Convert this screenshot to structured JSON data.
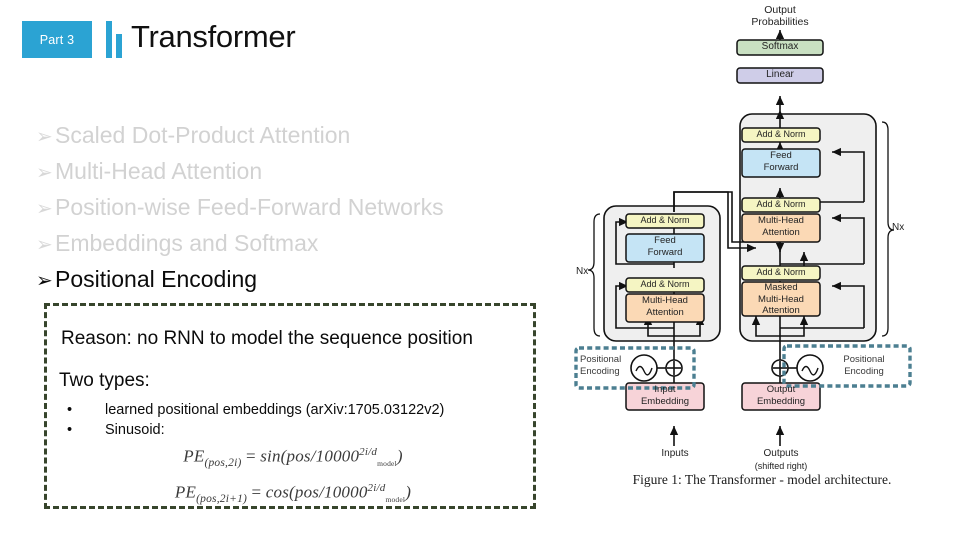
{
  "header": {
    "part_badge": "Part 3",
    "title": "Transformer",
    "accent_color": "#2ba3d3"
  },
  "outline": {
    "items": [
      {
        "bullet": "➢",
        "label": "Scaled Dot-Product Attention",
        "state": "dim"
      },
      {
        "bullet": "➢",
        "label": "Multi-Head Attention",
        "state": "dim"
      },
      {
        "bullet": "➢",
        "label": "Position-wise Feed-Forward Networks",
        "state": "dim"
      },
      {
        "bullet": "➢",
        "label": "Embeddings and Softmax",
        "state": "dim"
      },
      {
        "bullet": "➢",
        "label": "Positional Encoding",
        "state": "active"
      }
    ],
    "dim_color": "#d2d2d2",
    "active_color": "#0b0b0b"
  },
  "reason_box": {
    "border_color": "#37452c",
    "reason_line": "Reason: no RNN to model the sequence position",
    "two_types_heading": "Two types:",
    "sub_bullets": [
      {
        "marker": "•",
        "text": "learned positional embeddings (arXiv:1705.03122v2)"
      },
      {
        "marker": "•",
        "text": "Sinusoid:"
      }
    ],
    "formulas": [
      {
        "lhs_base": "PE",
        "lhs_sub": "(pos,2i)",
        "operator": "=",
        "fn": "sin",
        "arg_prefix": "(pos/10000",
        "exp_num": "2i/",
        "exp_sub": "d",
        "exp_subsub": "model",
        "arg_suffix": ")"
      },
      {
        "lhs_base": "PE",
        "lhs_sub": "(pos,2i+1)",
        "operator": "=",
        "fn": "cos",
        "arg_prefix": "(pos/10000",
        "exp_num": "2i/",
        "exp_sub": "d",
        "exp_subsub": "model",
        "arg_suffix": ")"
      }
    ]
  },
  "diagram": {
    "caption": "Figure 1: The Transformer - model architecture.",
    "top_label_line1": "Output",
    "top_label_line2": "Probabilities",
    "softmax": "Softmax",
    "linear": "Linear",
    "encoder": {
      "nx": "Nx",
      "add_norm_top": "Add & Norm",
      "feed_forward_line1": "Feed",
      "feed_forward_line2": "Forward",
      "add_norm_bottom": "Add & Norm",
      "attention_line1": "Multi-Head",
      "attention_line2": "Attention",
      "pos_enc_line1": "Positional",
      "pos_enc_line2": "Encoding",
      "embedding_line1": "Input",
      "embedding_line2": "Embedding",
      "source_label": "Inputs"
    },
    "decoder": {
      "nx": "Nx",
      "add_norm_top": "Add & Norm",
      "feed_forward_line1": "Feed",
      "feed_forward_line2": "Forward",
      "add_norm_mid": "Add & Norm",
      "attention_mid_line1": "Multi-Head",
      "attention_mid_line2": "Attention",
      "add_norm_bottom": "Add & Norm",
      "masked_line1": "Masked",
      "masked_line2": "Multi-Head",
      "masked_line3": "Attention",
      "pos_enc_line1": "Positional",
      "pos_enc_line2": "Encoding",
      "embedding_line1": "Output",
      "embedding_line2": "Embedding",
      "source_label_line1": "Outputs",
      "source_label_line2": "(shifted right)"
    },
    "colors": {
      "add_norm": "#f5f5c3",
      "feed_forward": "#c5e4f5",
      "attention": "#fbd9b5",
      "embedding": "#f7d3d8",
      "softmax": "#c9e0c2",
      "linear": "#cfcde8",
      "block_bg": "#efefef",
      "highlight_dashed": "#4c7f91"
    }
  }
}
